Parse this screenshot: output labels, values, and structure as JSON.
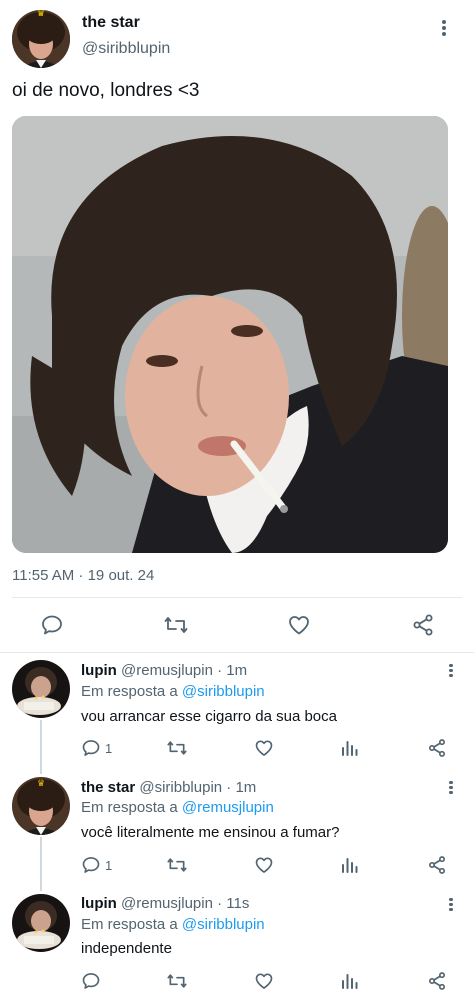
{
  "main_tweet": {
    "author_name": "the star",
    "author_handle": "@siribblupin",
    "text": "oi de novo, londres <3",
    "timestamp": "11:55 AM · 19 out. 24"
  },
  "replies": [
    {
      "name": "lupin",
      "handle_time": "@remusjlupin · 1m",
      "in_reply_prefix": "Em resposta a ",
      "in_reply_to": "@siribblupin",
      "text": "vou arrancar esse cigarro da sua boca",
      "reply_count": "1"
    },
    {
      "name": "the star",
      "handle_time": "@siribblupin · 1m",
      "in_reply_prefix": "Em resposta a ",
      "in_reply_to": "@remusjlupin",
      "text": "você literalmente me ensinou a fumar?",
      "reply_count": "1"
    },
    {
      "name": "lupin",
      "handle_time": "@remusjlupin · 11s",
      "in_reply_prefix": "Em resposta a ",
      "in_reply_to": "@siribblupin",
      "text": "independente",
      "reply_count": ""
    }
  ],
  "colors": {
    "link": "#1d9bf0",
    "secondary_text": "#536471",
    "icon": "#536471",
    "divider": "#e6e9eb"
  }
}
